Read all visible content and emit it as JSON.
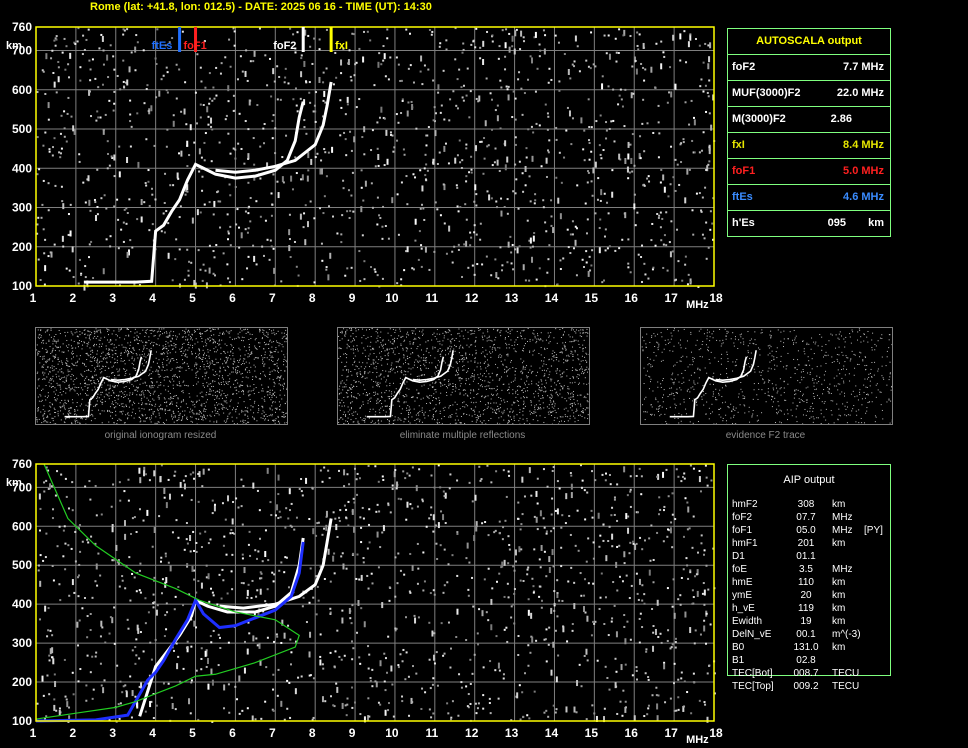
{
  "header": {
    "title": "Rome (lat: +41.8, lon: 012.5) - DATE: 2025 06 16 - TIME (UT): 14:30"
  },
  "axes": {
    "y_ticks": [
      "760",
      "700",
      "600",
      "500",
      "400",
      "300",
      "200",
      "100"
    ],
    "y_unit": "km",
    "x_ticks": [
      "1",
      "2",
      "3",
      "4",
      "5",
      "6",
      "7",
      "8",
      "9",
      "10",
      "11",
      "12",
      "13",
      "14",
      "15",
      "16",
      "17",
      "18"
    ],
    "x_unit": "MHz"
  },
  "markers": [
    {
      "label": "ftEs",
      "color": "#1f6fff"
    },
    {
      "label": "foF1",
      "color": "#ff2020"
    },
    {
      "label": "foF2",
      "color": "#ffffff"
    },
    {
      "label": "fxI",
      "color": "#ffff00"
    }
  ],
  "autoscala": {
    "title": "AUTOSCALA output",
    "rows": [
      {
        "label": "foF2",
        "value": "7.7 MHz",
        "color": "#ffffff"
      },
      {
        "label": "MUF(3000)F2",
        "value": "22.0 MHz",
        "color": "#ffffff"
      },
      {
        "label": "M(3000)F2",
        "value": "2.86",
        "color": "#ffffff"
      },
      {
        "label": "fxI",
        "value": "8.4 MHz",
        "color": "#e6e600"
      },
      {
        "label": "foF1",
        "value": "5.0 MHz",
        "color": "#ff2020"
      },
      {
        "label": "ftEs",
        "value": "4.6 MHz",
        "color": "#3a8cff"
      },
      {
        "label": "h'Es",
        "value": "095",
        "unit": "km",
        "color": "#ffffff"
      }
    ]
  },
  "thumbnails": [
    {
      "caption": "original ionogram resized"
    },
    {
      "caption": "eliminate multiple reflections"
    },
    {
      "caption": "evidence F2 trace"
    }
  ],
  "aip": {
    "title": "AIP output",
    "rows": [
      {
        "name": "hmF2",
        "value": "308",
        "unit": "km",
        "flag": ""
      },
      {
        "name": "foF2",
        "value": "07.7",
        "unit": "MHz",
        "flag": ""
      },
      {
        "name": "foF1",
        "value": "05.0",
        "unit": "MHz",
        "flag": "[PY]"
      },
      {
        "name": "hmF1",
        "value": "201",
        "unit": "km",
        "flag": ""
      },
      {
        "name": "D1",
        "value": "01.1",
        "unit": "",
        "flag": ""
      },
      {
        "name": "foE",
        "value": "3.5",
        "unit": "MHz",
        "flag": ""
      },
      {
        "name": "hmE",
        "value": "110",
        "unit": "km",
        "flag": ""
      },
      {
        "name": "ymE",
        "value": "20",
        "unit": "km",
        "flag": ""
      },
      {
        "name": "h_vE",
        "value": "119",
        "unit": "km",
        "flag": ""
      },
      {
        "name": "Ewidth",
        "value": "19",
        "unit": "km",
        "flag": ""
      },
      {
        "name": "DelN_vE",
        "value": "00.1",
        "unit": "m^(-3)",
        "flag": ""
      },
      {
        "name": "B0",
        "value": "131.0",
        "unit": "km",
        "flag": ""
      },
      {
        "name": "B1",
        "value": "02.8",
        "unit": "",
        "flag": ""
      },
      {
        "name": "TEC[Bot]",
        "value": "008.7",
        "unit": "TECU",
        "flag": ""
      },
      {
        "name": "TEC[Top]",
        "value": "009.2",
        "unit": "TECU",
        "flag": ""
      }
    ]
  },
  "chart_data": [
    {
      "type": "scatter",
      "title": "",
      "xlabel": "MHz",
      "ylabel": "km",
      "xlim": [
        1,
        18
      ],
      "ylim": [
        100,
        760
      ],
      "grid": true,
      "series": [
        {
          "name": "",
          "color": "#ffffff",
          "x": [
            2.2,
            3.0,
            3.5,
            3.9,
            4.0,
            4.2,
            4.4,
            4.6,
            4.8,
            5.0,
            5.2,
            5.5,
            6.0,
            6.5,
            7.0,
            7.3,
            7.5,
            7.6,
            7.7
          ],
          "y": [
            110,
            110,
            110,
            112,
            240,
            255,
            290,
            320,
            370,
            410,
            400,
            385,
            375,
            380,
            395,
            420,
            470,
            530,
            570
          ]
        },
        {
          "name": "",
          "color": "#ffffff",
          "x": [
            5.5,
            6.0,
            6.5,
            7.0,
            7.5,
            8.0,
            8.2,
            8.3,
            8.4
          ],
          "y": [
            395,
            390,
            395,
            405,
            420,
            460,
            510,
            560,
            620
          ]
        }
      ]
    },
    {
      "type": "scatter",
      "title": "",
      "xlabel": "MHz",
      "ylabel": "km",
      "xlim": [
        1,
        18
      ],
      "ylim": [
        100,
        760
      ],
      "grid": true,
      "series": [
        {
          "name": "",
          "color": "#ffffff",
          "x": [
            3.6,
            4.0,
            4.3,
            4.6,
            4.9,
            5.0,
            5.3,
            5.8,
            6.5,
            7.0,
            7.4,
            7.6,
            7.7
          ],
          "y": [
            112,
            240,
            280,
            320,
            370,
            410,
            395,
            380,
            380,
            395,
            430,
            500,
            570
          ]
        },
        {
          "name": "",
          "color": "#ffffff",
          "x": [
            5.6,
            6.2,
            7.0,
            7.6,
            8.0,
            8.2,
            8.3,
            8.4
          ],
          "y": [
            395,
            390,
            400,
            420,
            450,
            500,
            560,
            620
          ]
        },
        {
          "name": "",
          "color": "#1e2fff",
          "x": [
            1.0,
            2.5,
            3.3,
            3.8,
            4.0,
            4.2,
            4.5,
            4.8,
            5.0,
            5.2,
            5.6,
            6.0,
            6.5,
            7.0,
            7.4,
            7.6,
            7.7
          ],
          "y": [
            100,
            103,
            115,
            205,
            225,
            255,
            310,
            360,
            410,
            375,
            340,
            345,
            365,
            385,
            420,
            480,
            560
          ]
        },
        {
          "name": "",
          "color": "#22cc22",
          "x": [
            1.2,
            1.8,
            2.5,
            3.5,
            4.5,
            5.1,
            6.0,
            7.0,
            7.6,
            7.5,
            6.5,
            5.5,
            5.0,
            4.5,
            4.0,
            3.5,
            3.0,
            2.0,
            1.0
          ],
          "y": [
            760,
            620,
            550,
            480,
            440,
            410,
            380,
            360,
            320,
            290,
            250,
            220,
            215,
            190,
            170,
            150,
            135,
            120,
            105
          ]
        }
      ]
    }
  ]
}
